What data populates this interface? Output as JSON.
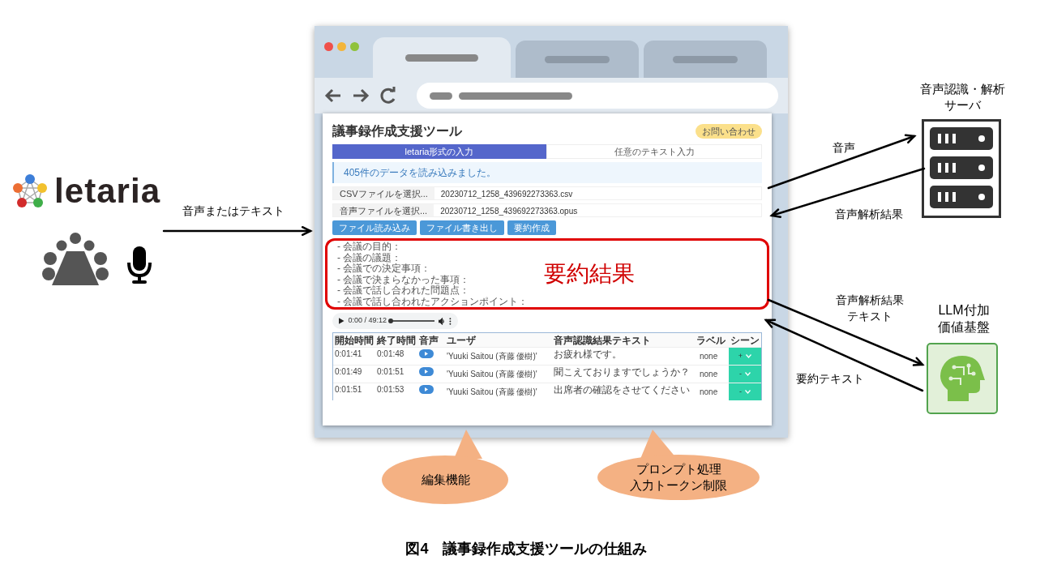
{
  "source": {
    "logo_text": "letaria",
    "arrow_label": "音声またはテキスト"
  },
  "browser": {
    "tabs": [
      {
        "selected": true
      },
      {
        "selected": false
      },
      {
        "selected": false
      }
    ],
    "app": {
      "title": "議事録作成支援ツール",
      "contact_button": "お問い合わせ",
      "tabs": [
        {
          "label": "letaria形式の入力",
          "selected": true
        },
        {
          "label": "任意のテキスト入力",
          "selected": false
        }
      ],
      "alert": "405件のデータを読み込みました。",
      "files": [
        {
          "button": "CSVファイルを選択...",
          "filename": "20230712_1258_439692273363.csv"
        },
        {
          "button": "音声ファイルを選択...",
          "filename": "20230712_1258_439692273363.opus"
        }
      ],
      "actions": [
        "ファイル読み込み",
        "ファイル書き出し",
        "要約作成"
      ],
      "summary_lines": [
        "- 会議の目的：",
        "- 会議の議題：",
        "- 会議での決定事項：",
        "- 会議で決まらなかった事項：",
        "- 会議で話し合われた問題点：",
        "- 会議で話し合われたアクションポイント："
      ],
      "summary_overlay": "要約結果",
      "audio": {
        "time": "0:00 / 49:12",
        "level": 0
      },
      "table": {
        "columns": [
          "開始時間",
          "終了時間",
          "音声",
          "ユーザ",
          "音声認識結果テキスト",
          "ラベル",
          "シーン"
        ],
        "rows": [
          {
            "start": "0:01:41",
            "end": "0:01:48",
            "user": "'Yuuki Saitou (斉藤 優樹)'",
            "text": "お疲れ様です。",
            "label": "none",
            "scene": "+"
          },
          {
            "start": "0:01:49",
            "end": "0:01:51",
            "user": "'Yuuki Saitou (斉藤 優樹)'",
            "text": "聞こえておりますでしょうか？",
            "label": "none",
            "scene": "-"
          },
          {
            "start": "0:01:51",
            "end": "0:01:53",
            "user": "'Yuuki Saitou (斉藤 優樹)'",
            "text": "出席者の確認をさせてください",
            "label": "none",
            "scene": "-"
          }
        ]
      }
    }
  },
  "server": {
    "label": [
      "音声認識・解析",
      "サーバ"
    ],
    "send_label": "音声",
    "return_label": "音声解析結果"
  },
  "llm": {
    "label": [
      "LLM付加",
      "価値基盤"
    ],
    "send_label": [
      "音声解析結果",
      "テキスト"
    ],
    "return_label": "要約テキスト"
  },
  "callouts": [
    {
      "lines": [
        "編集機能"
      ]
    },
    {
      "lines": [
        "プロンプト処理",
        "入力トークン制限"
      ]
    }
  ],
  "caption": "図4　議事録作成支援ツールの仕組み"
}
